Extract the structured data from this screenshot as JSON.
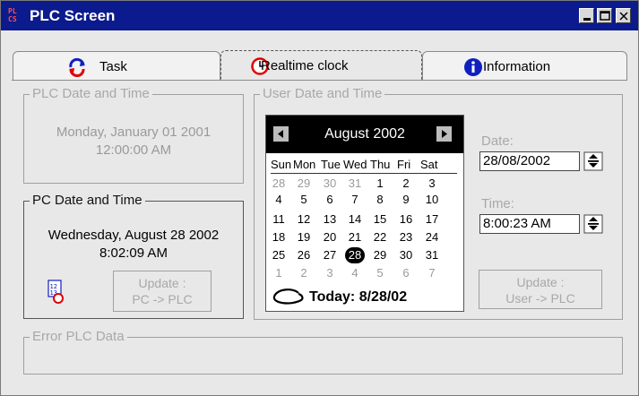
{
  "window": {
    "title": "PLC Screen",
    "app_icon_text_top": "PL",
    "app_icon_text_bottom": "CS"
  },
  "tabs": [
    {
      "label": "Task",
      "icon": "cycle-arrows-icon",
      "active": false
    },
    {
      "label": "Realtime clock",
      "icon": "clock-icon",
      "active": true
    },
    {
      "label": "Information",
      "icon": "info-icon",
      "active": false
    }
  ],
  "plc_group": {
    "title": "PLC Date and Time",
    "date_line": "Monday, January 01 2001",
    "time_line": "12:00:00 AM"
  },
  "pc_group": {
    "title": "PC Date and Time",
    "date_line": "Wednesday, August 28 2002",
    "time_line": "8:02:09 AM",
    "update_line1": "Update :",
    "update_line2": "PC -> PLC"
  },
  "user_group": {
    "title": "User Date and Time",
    "calendar": {
      "month_label": "August 2002",
      "weekdays": [
        "Sun",
        "Mon",
        "Tue",
        "Wed",
        "Thu",
        "Fri",
        "Sat"
      ],
      "weeks": [
        [
          "28",
          "29",
          "30",
          "31",
          "1",
          "2",
          "3"
        ],
        [
          "4",
          "5",
          "6",
          "7",
          "8",
          "9",
          "10"
        ],
        [
          "11",
          "12",
          "13",
          "14",
          "15",
          "16",
          "17"
        ],
        [
          "18",
          "19",
          "20",
          "21",
          "22",
          "23",
          "24"
        ],
        [
          "25",
          "26",
          "27",
          "28",
          "29",
          "30",
          "31"
        ],
        [
          "1",
          "2",
          "3",
          "4",
          "5",
          "6",
          "7"
        ]
      ],
      "selected_day": "28",
      "today_label": "Today: 8/28/02"
    },
    "date_label": "Date:",
    "date_value": "28/08/2002",
    "time_label": "Time:",
    "time_value": "8:00:23 AM",
    "update_line1": "Update :",
    "update_line2": "User -> PLC"
  },
  "error_group": {
    "title": "Error PLC Data"
  },
  "colors": {
    "titlebar": "#0b1a8c",
    "window_bg": "#e8e8e8",
    "disabled_text": "#a8a8a8",
    "selected_day_bg": "#000000",
    "clock_icon_red": "#e00000",
    "info_icon_blue": "#1020c0"
  }
}
